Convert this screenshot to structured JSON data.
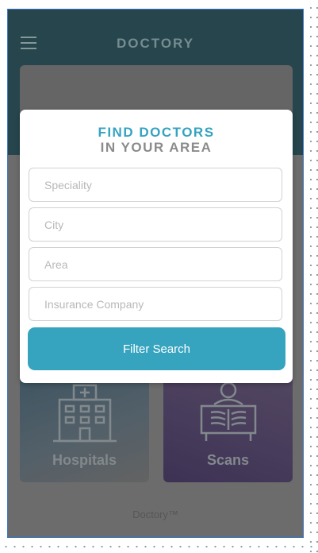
{
  "app": {
    "title": "DOCTORY",
    "footer": "Doctory™"
  },
  "header": {
    "menu_icon": "hamburger-icon"
  },
  "tiles": [
    {
      "label": "Hospitals",
      "icon": "hospital-icon"
    },
    {
      "label": "Scans",
      "icon": "xray-scan-icon"
    }
  ],
  "modal": {
    "title_line1": "FIND DOCTORS",
    "title_line2": "IN YOUR AREA",
    "fields": [
      {
        "placeholder": "Speciality",
        "value": ""
      },
      {
        "placeholder": "City",
        "value": ""
      },
      {
        "placeholder": "Area",
        "value": ""
      },
      {
        "placeholder": "Insurance Company",
        "value": ""
      }
    ],
    "button_label": "Filter Search"
  },
  "colors": {
    "header": "#1f4952",
    "accent": "#36a3bf",
    "title_accent": "#35a3c0",
    "frame_border": "#3b78c4"
  }
}
